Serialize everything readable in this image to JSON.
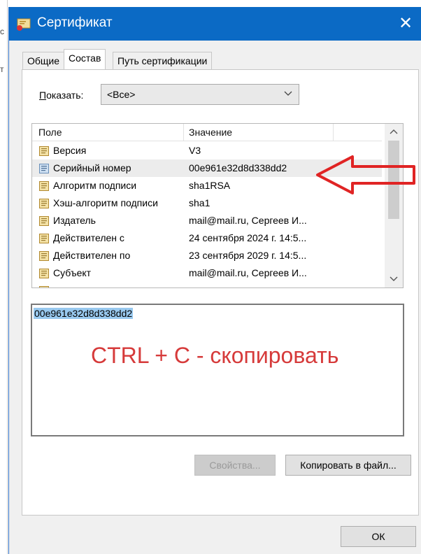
{
  "window": {
    "title": "Сертификат",
    "edge_fragments": [
      "с",
      "т"
    ]
  },
  "tabs": [
    {
      "label": "Общие",
      "active": false
    },
    {
      "label": "Состав",
      "active": true
    },
    {
      "label": "Путь сертификации",
      "active": false
    }
  ],
  "show": {
    "label_prefix": "П",
    "label_rest": "оказать:",
    "selected": "<Все>"
  },
  "list": {
    "columns": [
      "Поле",
      "Значение"
    ],
    "rows": [
      {
        "name": "Версия",
        "value": "V3"
      },
      {
        "name": "Серийный номер",
        "value": "00e961e32d8d338dd2",
        "selected": true
      },
      {
        "name": "Алгоритм подписи",
        "value": "sha1RSA"
      },
      {
        "name": "Хэш-алгоритм подписи",
        "value": "sha1"
      },
      {
        "name": "Издатель",
        "value": "mail@mail.ru, Сергеев И..."
      },
      {
        "name": "Действителен с",
        "value": "24 сентября 2024 г. 14:5..."
      },
      {
        "name": "Действителен по",
        "value": "23 сентября 2029 г. 14:5..."
      },
      {
        "name": "Субъект",
        "value": "mail@mail.ru, Сергеев И..."
      }
    ]
  },
  "detail": {
    "text": "00e961e32d8d338dd2"
  },
  "annotation": {
    "text": "CTRL + C - скопировать",
    "color": "#d63a3a"
  },
  "buttons": {
    "properties": "Свойства...",
    "copy_to_file": "Копировать в файл...",
    "ok": "ОК"
  },
  "colors": {
    "titlebar": "#0b6ac5",
    "selection": "#99c9ef",
    "arrow": "#e02424"
  }
}
